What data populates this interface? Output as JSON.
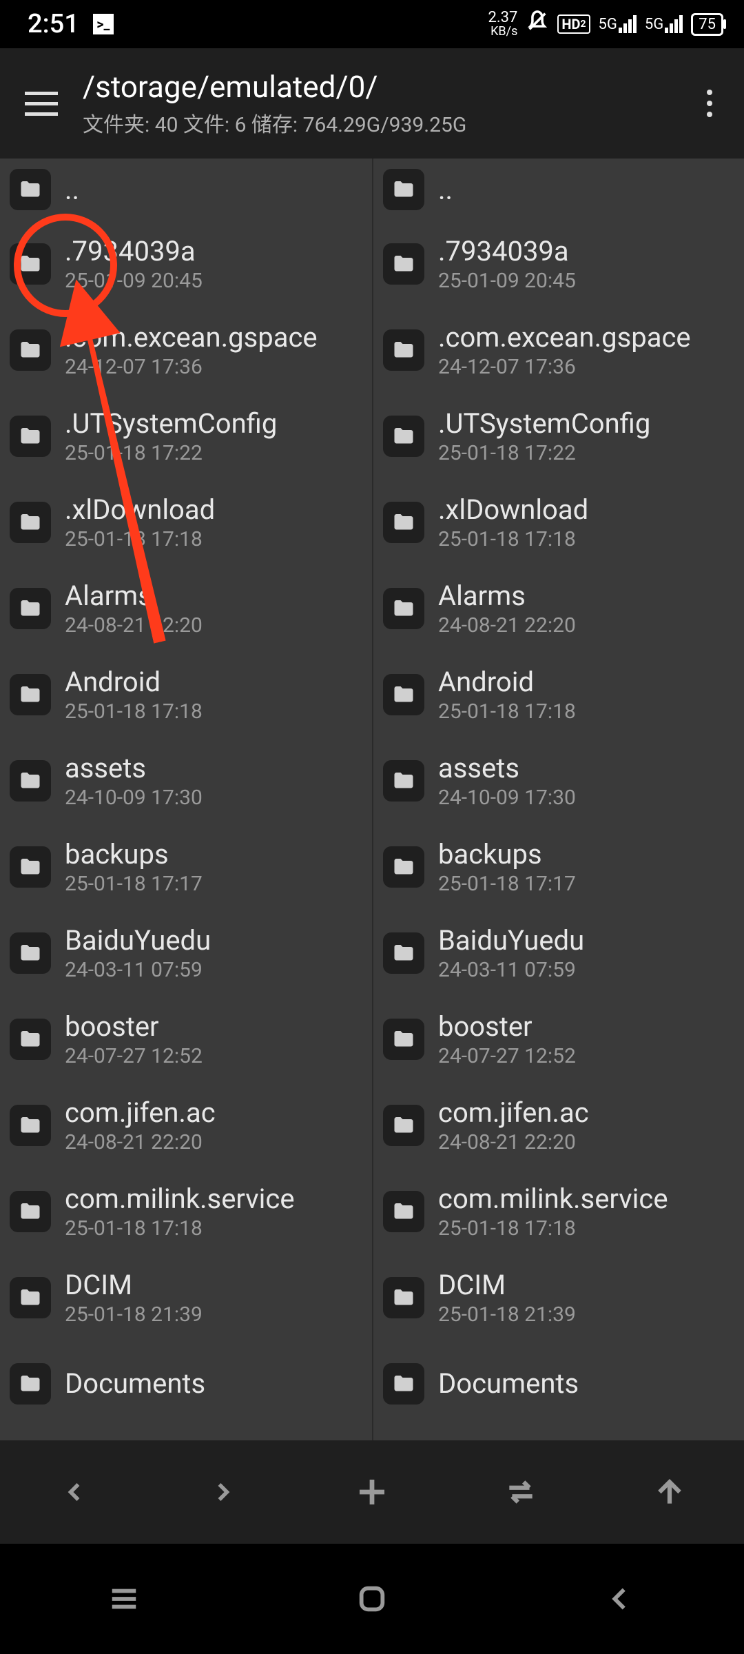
{
  "statusBar": {
    "time": "2:51",
    "netSpeed": {
      "value": "2.37",
      "unit": "KB/s"
    },
    "hd": "HD",
    "hdSub": "2",
    "sig1": "5G",
    "sig2": "5G",
    "battery": "75"
  },
  "header": {
    "path": "/storage/emulated/0/",
    "stats": "文件夹: 40  文件: 6  储存: 764.29G/939.25G"
  },
  "left": {
    "items": [
      {
        "name": "..",
        "date": ""
      },
      {
        "name": ".7934039a",
        "date": "25-01-09 20:45"
      },
      {
        "name": ".com.excean.gspace",
        "date": "24-12-07 17:36"
      },
      {
        "name": ".UTSystemConfig",
        "date": "25-01-18 17:22"
      },
      {
        "name": ".xlDownload",
        "date": "25-01-18 17:18"
      },
      {
        "name": "Alarms",
        "date": "24-08-21 22:20"
      },
      {
        "name": "Android",
        "date": "25-01-18 17:18"
      },
      {
        "name": "assets",
        "date": "24-10-09 17:30"
      },
      {
        "name": "backups",
        "date": "25-01-18 17:17"
      },
      {
        "name": "BaiduYuedu",
        "date": "24-03-11 07:59"
      },
      {
        "name": "booster",
        "date": "24-07-27 12:52"
      },
      {
        "name": "com.jifen.ac",
        "date": "24-08-21 22:20"
      },
      {
        "name": "com.milink.service",
        "date": "25-01-18 17:18"
      },
      {
        "name": "DCIM",
        "date": "25-01-18 21:39"
      },
      {
        "name": "Documents",
        "date": ""
      }
    ]
  },
  "right": {
    "items": [
      {
        "name": "..",
        "date": ""
      },
      {
        "name": ".7934039a",
        "date": "25-01-09 20:45"
      },
      {
        "name": ".com.excean.gspace",
        "date": "24-12-07 17:36"
      },
      {
        "name": ".UTSystemConfig",
        "date": "25-01-18 17:22"
      },
      {
        "name": ".xlDownload",
        "date": "25-01-18 17:18"
      },
      {
        "name": "Alarms",
        "date": "24-08-21 22:20"
      },
      {
        "name": "Android",
        "date": "25-01-18 17:18"
      },
      {
        "name": "assets",
        "date": "24-10-09 17:30"
      },
      {
        "name": "backups",
        "date": "25-01-18 17:17"
      },
      {
        "name": "BaiduYuedu",
        "date": "24-03-11 07:59"
      },
      {
        "name": "booster",
        "date": "24-07-27 12:52"
      },
      {
        "name": "com.jifen.ac",
        "date": "24-08-21 22:20"
      },
      {
        "name": "com.milink.service",
        "date": "25-01-18 17:18"
      },
      {
        "name": "DCIM",
        "date": "25-01-18 21:39"
      },
      {
        "name": "Documents",
        "date": ""
      }
    ]
  }
}
